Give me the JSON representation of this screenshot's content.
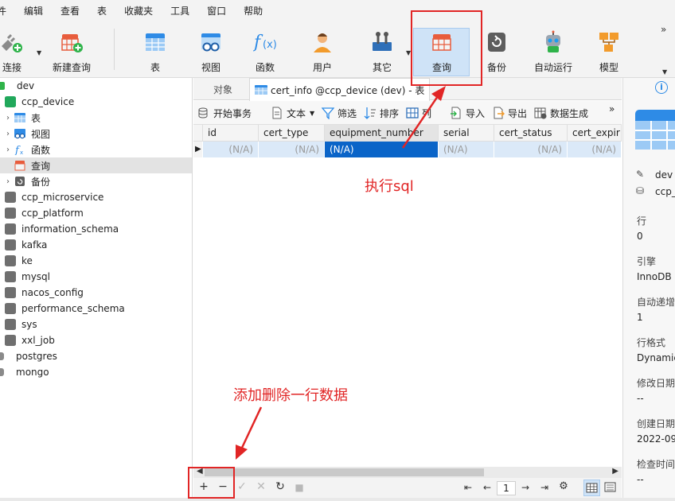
{
  "menu": [
    "件",
    "编辑",
    "查看",
    "表",
    "收藏夹",
    "工具",
    "窗口",
    "帮助"
  ],
  "toolbar": {
    "connect": "连接",
    "new_query": "新建查询",
    "table": "表",
    "view": "视图",
    "function": "函数",
    "user": "用户",
    "other": "其它",
    "query": "查询",
    "backup": "备份",
    "automation": "自动运行",
    "model": "模型",
    "more": "»"
  },
  "tree": {
    "connection": "dev",
    "current_db": "ccp_device",
    "children": [
      "表",
      "视图",
      "函数",
      "查询",
      "备份"
    ],
    "databases": [
      "ccp_microservice",
      "ccp_platform",
      "information_schema",
      "kafka",
      "ke",
      "mysql",
      "nacos_config",
      "performance_schema",
      "sys",
      "xxl_job"
    ],
    "other_connections": [
      "postgres",
      "mongo"
    ]
  },
  "tabs": {
    "objects": "对象",
    "active": "cert_info @ccp_device (dev) - 表"
  },
  "subtoolbar": {
    "begin_tx": "开始事务",
    "text": "文本",
    "filter": "筛选",
    "sort": "排序",
    "column": "列",
    "import": "导入",
    "export": "导出",
    "datagen": "数据生成",
    "more": "»"
  },
  "grid": {
    "columns": [
      "id",
      "cert_type",
      "equipment_number",
      "serial",
      "cert_status",
      "cert_expir"
    ],
    "row": [
      "(N/A)",
      "(N/A)",
      "(N/A)",
      "(N/A)",
      "(N/A)",
      "(N/A)"
    ],
    "row_marker": "▶"
  },
  "pager": {
    "page": "1"
  },
  "info_panel": {
    "connection": "dev",
    "database": "ccp_",
    "rows_label": "行",
    "rows_value": "0",
    "engine_label": "引擎",
    "engine_value": "InnoDB",
    "autoinc_label": "自动递增",
    "autoinc_value": "1",
    "rowformat_label": "行格式",
    "rowformat_value": "Dynamic",
    "modified_label": "修改日期",
    "modified_value": "--",
    "created_label": "创建日期",
    "created_value": "2022-09-",
    "checked_label": "检查时间",
    "checked_value": "--"
  },
  "annotations": {
    "execute_sql": "执行sql",
    "add_delete_row": "添加删除一行数据"
  },
  "colors": {
    "annotation_red": "#e12525",
    "selection_blue": "#0a64c8",
    "row_highlight": "#dbe9f8",
    "db_green": "#21a85b"
  }
}
